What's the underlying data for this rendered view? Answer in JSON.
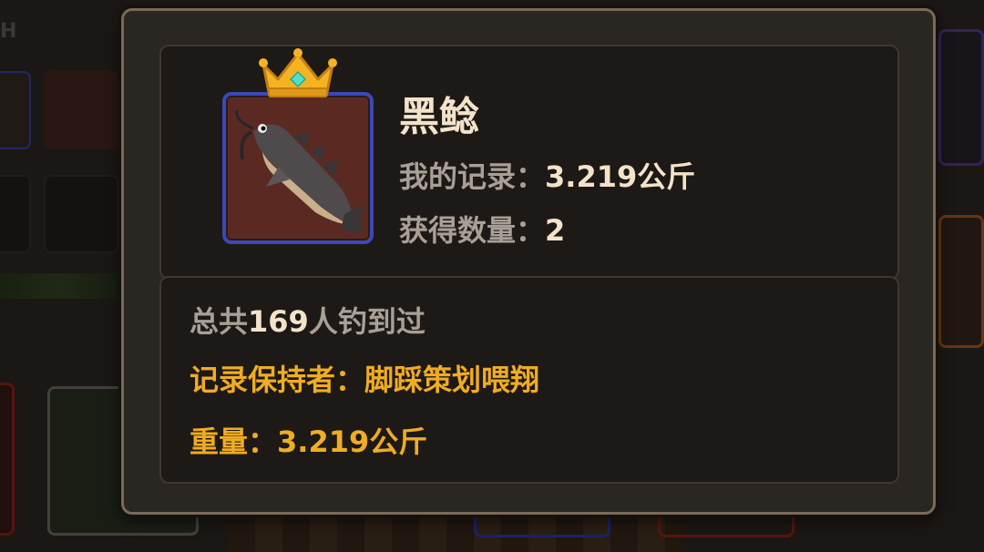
{
  "background": {
    "section_letter": "H"
  },
  "fish": {
    "name": "黑鲶",
    "icon": "catfish-icon",
    "crown_icon": "crown-icon",
    "frame_color": "#3d47b8",
    "my_record_label": "我的记录：",
    "my_record_value": "3.219公斤",
    "count_label": "获得数量：",
    "count_value": "2"
  },
  "stats": {
    "total_prefix": "总共",
    "total_value": "169",
    "total_suffix": "人钓到过",
    "holder_label": "记录保持者：",
    "holder_name": "脚踩策划喂翔",
    "weight_label": "重量：",
    "weight_value": "3.219公斤"
  },
  "colors": {
    "gold_text": "#f0ac22",
    "label_text": "#a8a097",
    "value_text": "#f3e3cb"
  }
}
